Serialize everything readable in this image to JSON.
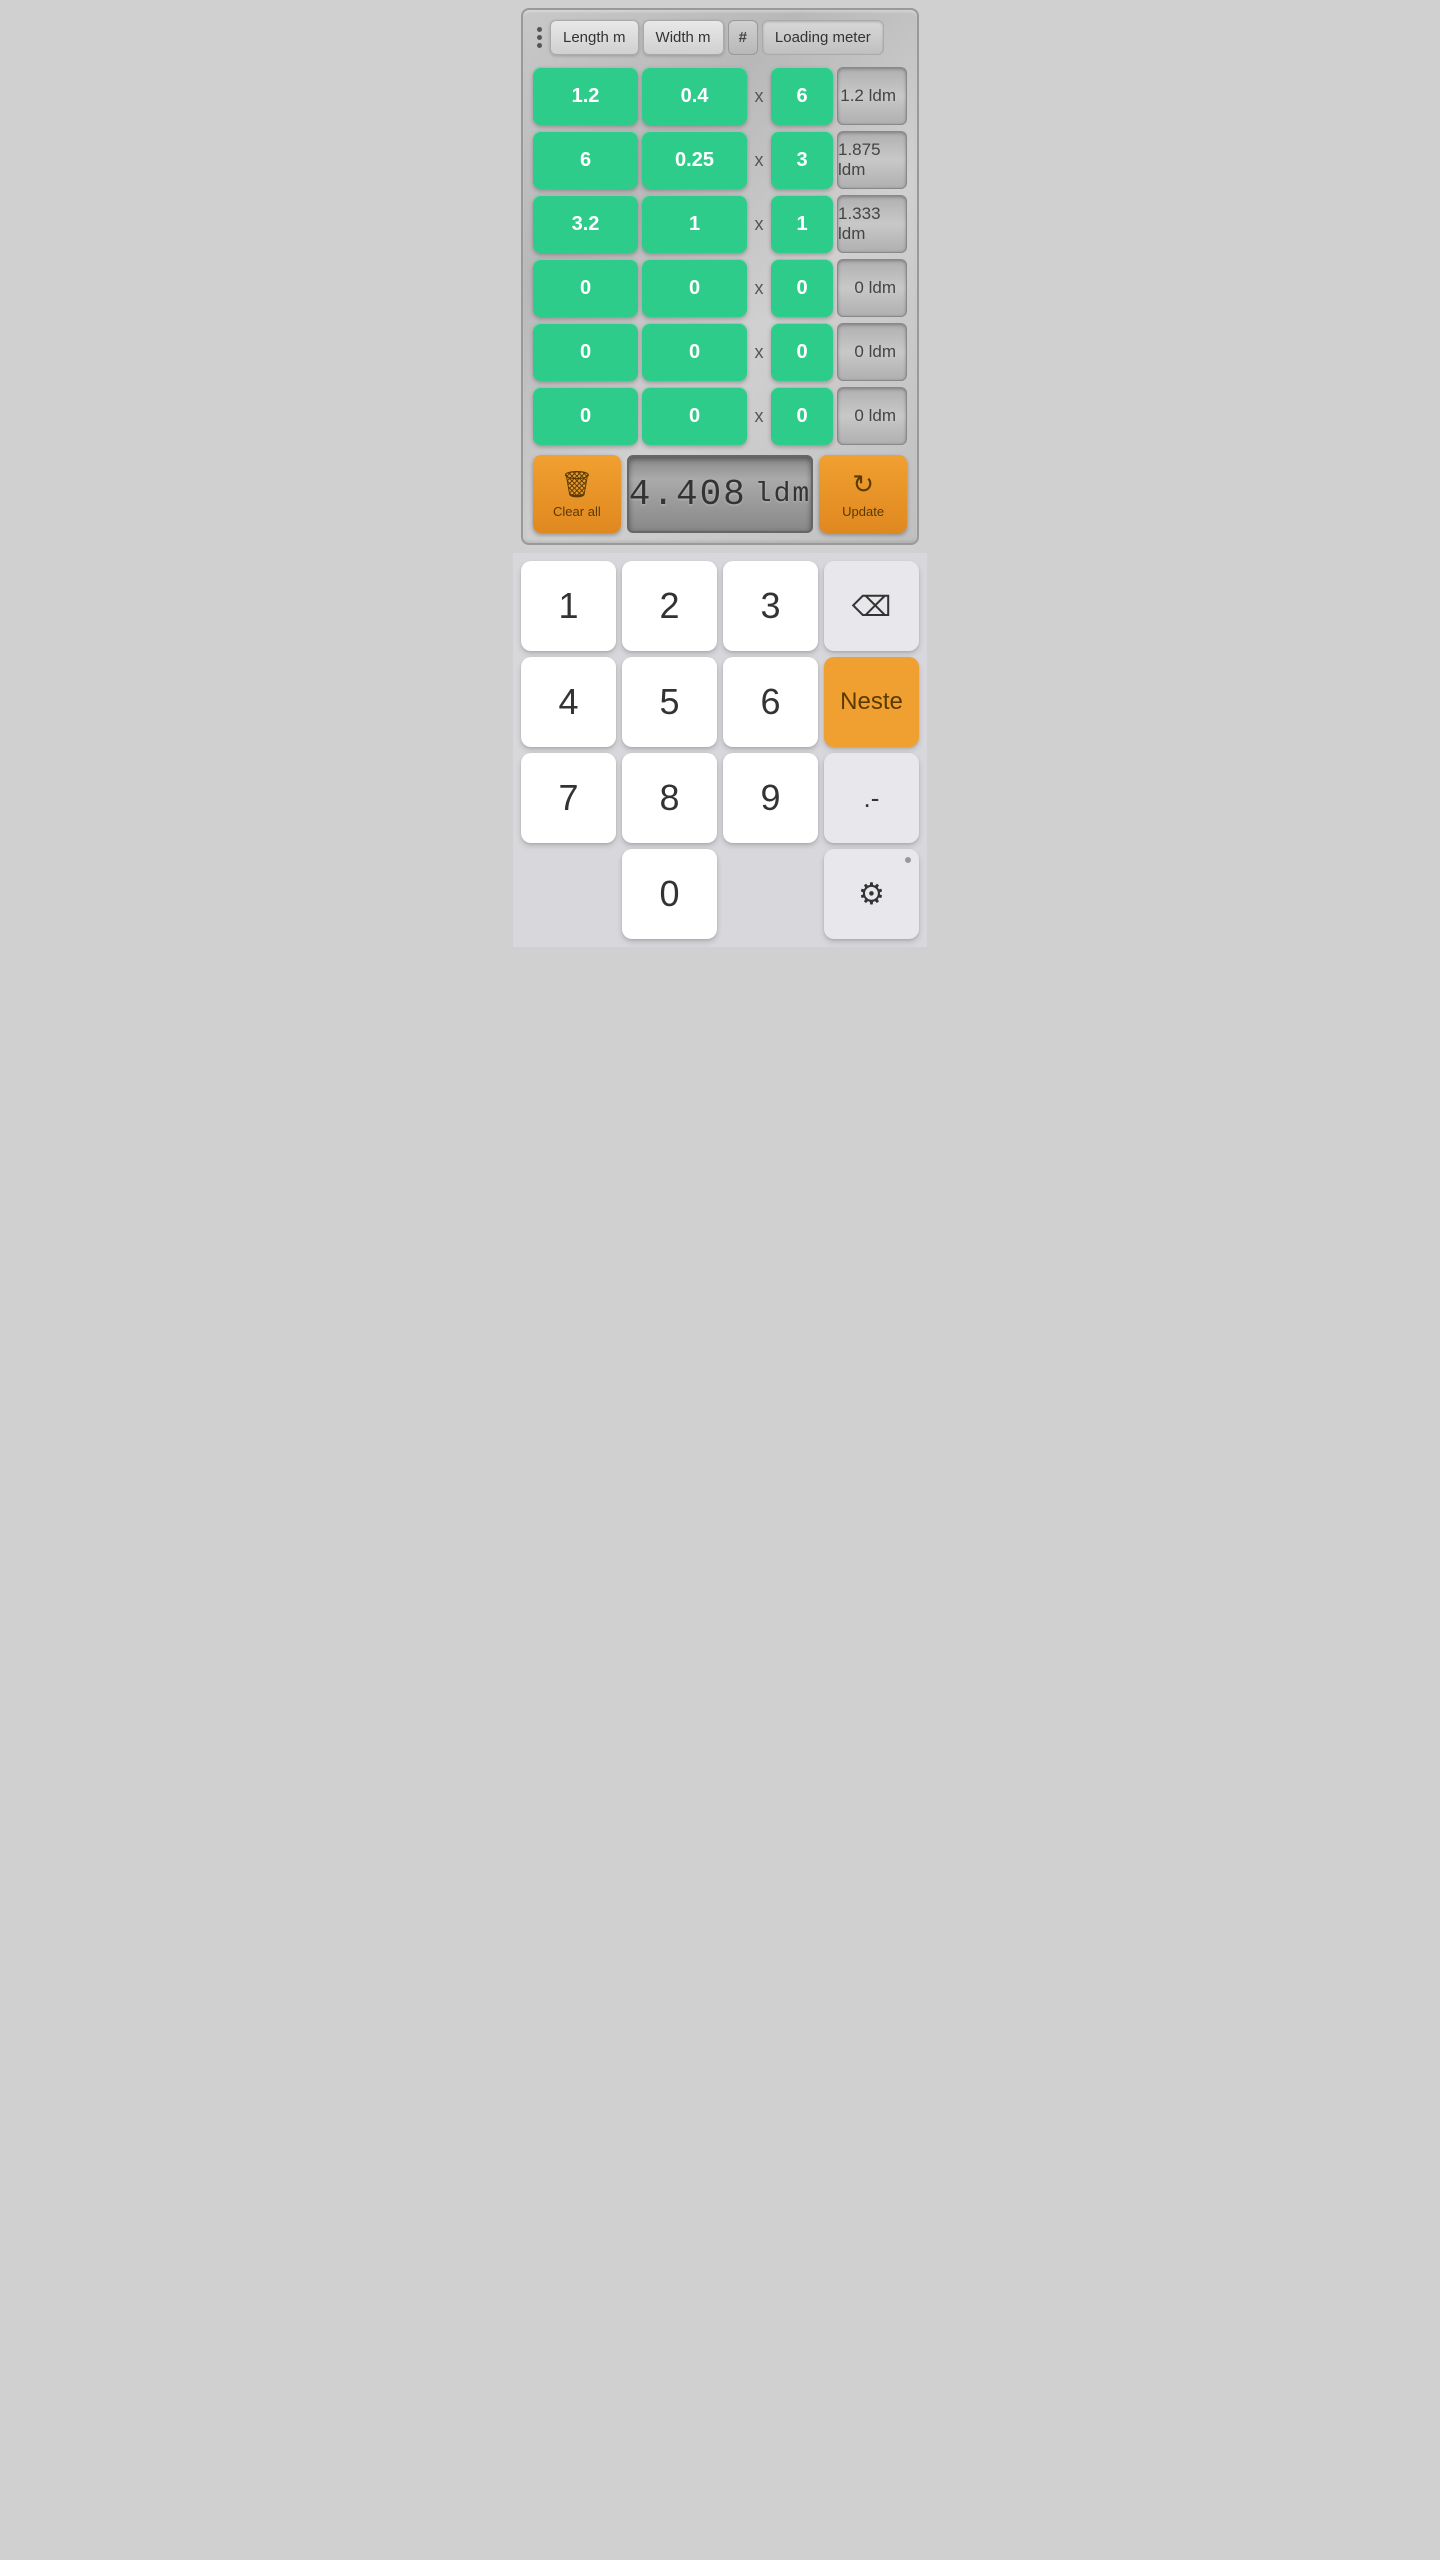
{
  "header": {
    "length_tab": "Length m",
    "width_tab": "Width m",
    "hash_tab": "#",
    "loading_tab": "Loading meter"
  },
  "rows": [
    {
      "length": "1.2",
      "width": "0.4",
      "qty": "6",
      "result": "1.2 ldm"
    },
    {
      "length": "6",
      "width": "0.25",
      "qty": "3",
      "result": "1.875 ldm"
    },
    {
      "length": "3.2",
      "width": "1",
      "qty": "1",
      "result": "1.333 ldm"
    },
    {
      "length": "0",
      "width": "0",
      "qty": "0",
      "result": "0 ldm"
    },
    {
      "length": "0",
      "width": "0",
      "qty": "0",
      "result": "0 ldm"
    },
    {
      "length": "0",
      "width": "0",
      "qty": "0",
      "result": "0 ldm"
    }
  ],
  "footer": {
    "clear_label": "Clear all",
    "total": "4.408",
    "total_unit": "ldm",
    "update_label": "Update"
  },
  "numpad": {
    "keys": [
      "1",
      "2",
      "3",
      "⌫",
      "4",
      "5",
      "6",
      "Neste",
      "7",
      "8",
      "9",
      ".-",
      "",
      "0",
      "",
      "⚙"
    ]
  }
}
